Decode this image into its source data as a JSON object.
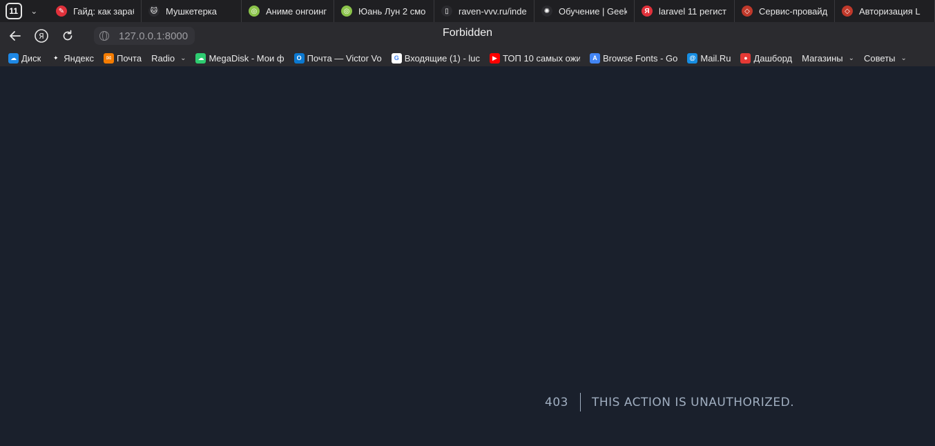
{
  "tabstrip": {
    "tab_count": "11",
    "tabs": [
      {
        "label": "Гайд: как зарабо",
        "icon": "red-circle-icon",
        "color": "#e0313b",
        "glyph": "✎",
        "width": 134
      },
      {
        "label": "Мушкетерка",
        "icon": "cat-icon",
        "color": "#2b2b2f",
        "glyph": "🐱",
        "width": 145
      },
      {
        "label": "Аниме онгоинги",
        "icon": "spiral-icon",
        "color": "#8bc34a",
        "glyph": "◎",
        "width": 134
      },
      {
        "label": "Юань Лун 2 смо",
        "icon": "spiral-icon",
        "color": "#8bc34a",
        "glyph": "◎",
        "width": 145
      },
      {
        "label": "raven-vvv.ru/inde",
        "icon": "page-icon",
        "color": "#2b2b2f",
        "glyph": "▯",
        "width": 145
      },
      {
        "label": "Обучение | Geek",
        "icon": "openai-icon",
        "color": "#2b2b2f",
        "glyph": "✺",
        "width": 145
      },
      {
        "label": "laravel 11 регист",
        "icon": "yandex-icon",
        "color": "#e0313b",
        "glyph": "Я",
        "width": 145
      },
      {
        "label": "Сервис-провайд",
        "icon": "laravel-icon",
        "color": "#c0392b",
        "glyph": "◇",
        "width": 145
      },
      {
        "label": "Авторизация L",
        "icon": "laravel-icon",
        "color": "#c0392b",
        "glyph": "◇",
        "width": 145
      }
    ]
  },
  "toolbar": {
    "url": "127.0.0.1:8000",
    "page_title": "Forbidden"
  },
  "bookmarks": [
    {
      "label": "Диск",
      "color": "#1e88e5",
      "glyph": "☁",
      "dropdown": false
    },
    {
      "label": "Яндекс",
      "color": "#2b2b2f",
      "glyph": "✦",
      "dropdown": false
    },
    {
      "label": "Почта",
      "color": "#f57c00",
      "glyph": "✉",
      "dropdown": false
    },
    {
      "label": "Radio",
      "color": "",
      "glyph": "",
      "dropdown": true
    },
    {
      "label": "MegaDisk - Мои ф",
      "color": "#2ecc71",
      "glyph": "☁",
      "dropdown": false
    },
    {
      "label": "Почта — Victor Vo",
      "color": "#0b78d0",
      "glyph": "O",
      "dropdown": false
    },
    {
      "label": "Входящие (1) - luc",
      "color": "#ffffff",
      "glyph": "G",
      "dropdown": false
    },
    {
      "label": "ТОП 10 самых ожи",
      "color": "#ff0000",
      "glyph": "▶",
      "dropdown": false
    },
    {
      "label": "Browse Fonts - Go",
      "color": "#4285f4",
      "glyph": "A",
      "dropdown": false
    },
    {
      "label": "Mail.Ru",
      "color": "#168de2",
      "glyph": "@",
      "dropdown": false
    },
    {
      "label": "Дашборд",
      "color": "#e53935",
      "glyph": "●",
      "dropdown": false
    },
    {
      "label": "Магазины",
      "color": "",
      "glyph": "",
      "dropdown": true
    },
    {
      "label": "Советы",
      "color": "",
      "glyph": "",
      "dropdown": true
    }
  ],
  "error": {
    "code": "403",
    "message": "This action is unauthorized."
  }
}
